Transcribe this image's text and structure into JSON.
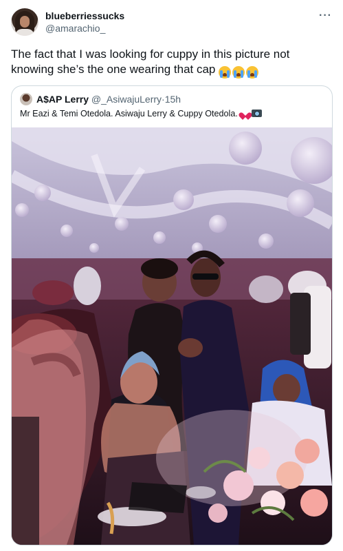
{
  "tweet": {
    "display_name": "blueberriessucks",
    "handle": "@amarachio_",
    "more_icon": "more-options-icon",
    "text": "The fact that I was looking for cuppy in this picture not knowing she’s the one wearing that cap",
    "emojis": [
      "loudly-crying-face-emoji",
      "loudly-crying-face-emoji",
      "loudly-crying-face-emoji"
    ]
  },
  "quoted_tweet": {
    "display_name": "A$AP Lerry",
    "handle": "@_AsiwajuLerry",
    "separator": "·",
    "time": "15h",
    "text": "Mr Eazi & Temi Otedola. Asiwaju Lerry & Cuppy Otedola.",
    "emojis": [
      "red-heart-emoji",
      "camera-with-flash-emoji"
    ],
    "image": "event-photo"
  },
  "colors": {
    "text_primary": "#0f1419",
    "text_secondary": "#536471",
    "border": "#cfd9de"
  }
}
